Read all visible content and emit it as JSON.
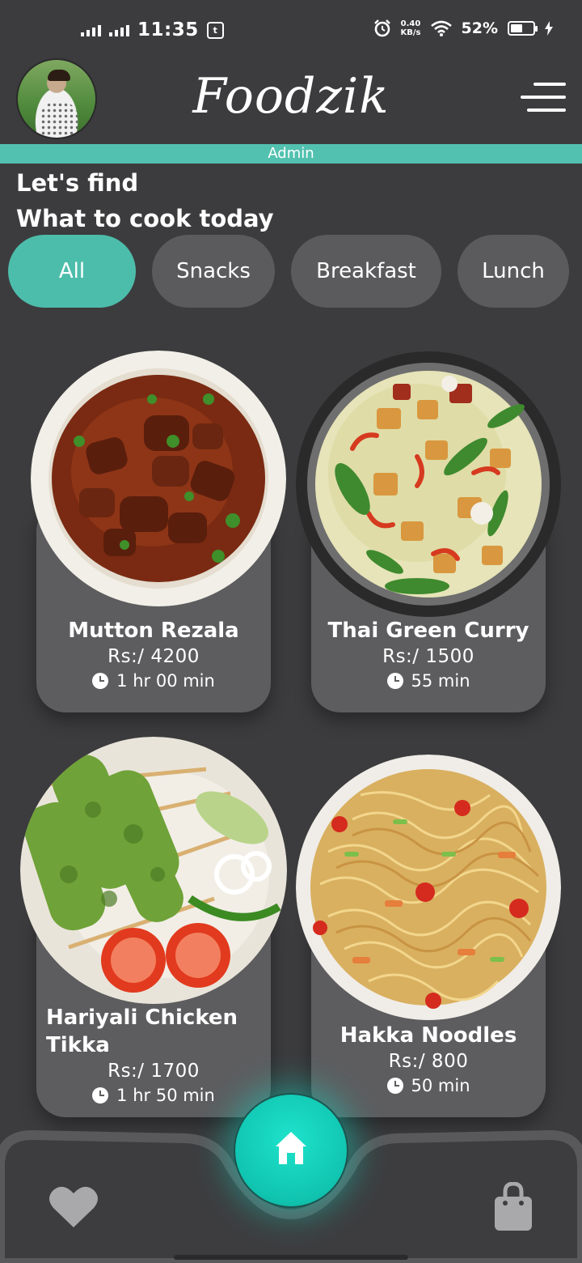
{
  "status_bar": {
    "time": "11:35",
    "badge": "t",
    "net_speed_value": "0.40",
    "net_speed_unit": "KB/s",
    "battery_percent": "52%",
    "battery_level": 0.52
  },
  "header": {
    "brand": "Foodzik",
    "role_banner": "Admin"
  },
  "greeting": {
    "line1": "Let's find",
    "line2": "What to cook today"
  },
  "categories": [
    {
      "label": "All",
      "active": true
    },
    {
      "label": "Snacks",
      "active": false
    },
    {
      "label": "Breakfast",
      "active": false
    },
    {
      "label": "Lunch",
      "active": false
    }
  ],
  "foods": [
    {
      "name": "Mutton Rezala",
      "price": "Rs:/ 4200",
      "time": "1 hr 00 min"
    },
    {
      "name": "Thai Green Curry",
      "price": "Rs:/ 1500",
      "time": "55 min"
    },
    {
      "name": "Hariyali Chicken Tikka",
      "price": "Rs:/ 1700",
      "time": "1 hr 50 min"
    },
    {
      "name": "Hakka Noodles",
      "price": "Rs:/ 800",
      "time": "50 min"
    }
  ],
  "nav": {
    "left_icon": "heart-icon",
    "center_icon": "home-icon",
    "right_icon": "shopping-bag-icon"
  },
  "colors": {
    "background": "#3c3c3e",
    "accent": "#4dbdab",
    "card": "#5d5d5f",
    "chip": "#5b5b5d",
    "fab": "#10c4b0"
  }
}
